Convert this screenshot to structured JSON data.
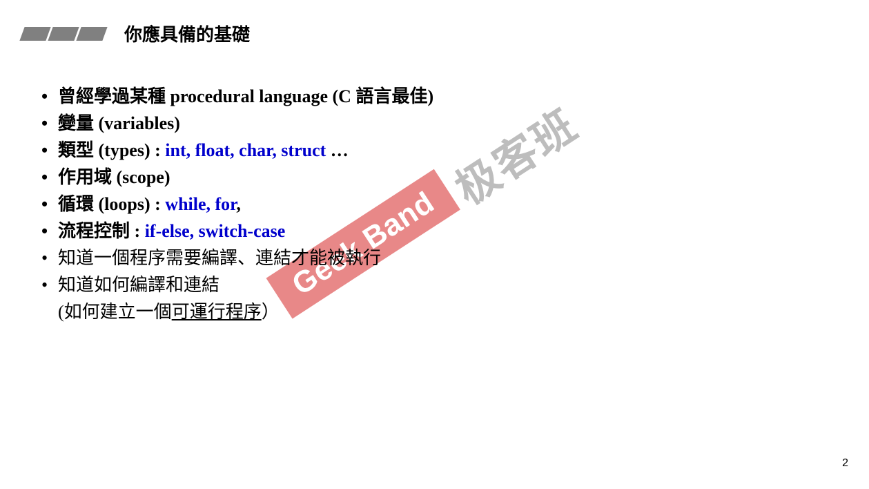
{
  "title": "你應具備的基礎",
  "bullets": {
    "b1": "曾經學過某種",
    "b1_en": " procedural language (C ",
    "b1_tail": "語言最佳",
    "b1_close": ")",
    "s1": "變量",
    "s1_en": " (variables)",
    "s2": "類型",
    "s2_en": " (types) : ",
    "s2_blue": "int, float, char, struct",
    "s2_tail": " …",
    "s3": "作用域",
    "s3_en": " (scope)",
    "s4": "循環",
    "s4_en": " (loops) : ",
    "s4_blue": "while, for",
    "s4_tail": ",",
    "s5": "流程控制",
    "s5_en": " : ",
    "s5_blue": "if-else, switch-case",
    "b2": "知道一個程序需要編譯、連結才能被執行",
    "b3": "知道如何編譯和連結",
    "b3l2_open": "(",
    "b3l2_a": "如何建立一個",
    "b3l2_u": "可運行程序",
    "b3l2_close": "）"
  },
  "watermark": {
    "en": "Geek Band",
    "cn": "极客班"
  },
  "page_number": "2"
}
